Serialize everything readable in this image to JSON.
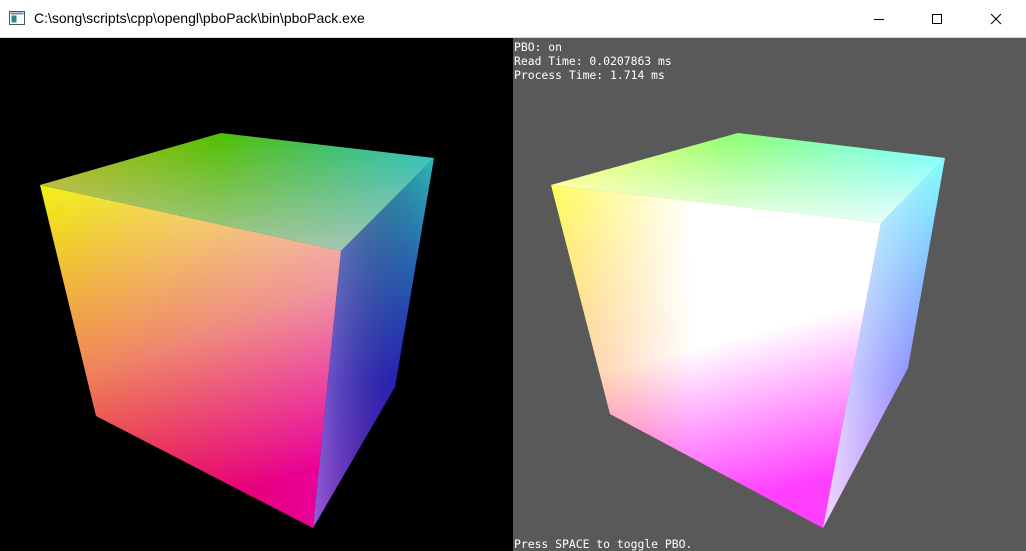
{
  "window": {
    "title": "C:\\song\\scripts\\cpp\\opengl\\pboPack\\bin\\pboPack.exe",
    "icons": {
      "app": "window-app-icon",
      "minimize": "minimize-icon",
      "maximize": "maximize-icon",
      "close": "close-icon"
    }
  },
  "right_view": {
    "background": "#595959",
    "info": {
      "pbo": "PBO: on",
      "read_time": "Read Time: 0.0207863 ms",
      "process_time": "Process Time: 1.714 ms"
    },
    "hint": "Press SPACE to toggle PBO."
  },
  "colors": {
    "left_background": "#000000",
    "right_background": "#595959",
    "titlebar_background": "#ffffff",
    "overlay_text": "#ffffff"
  }
}
